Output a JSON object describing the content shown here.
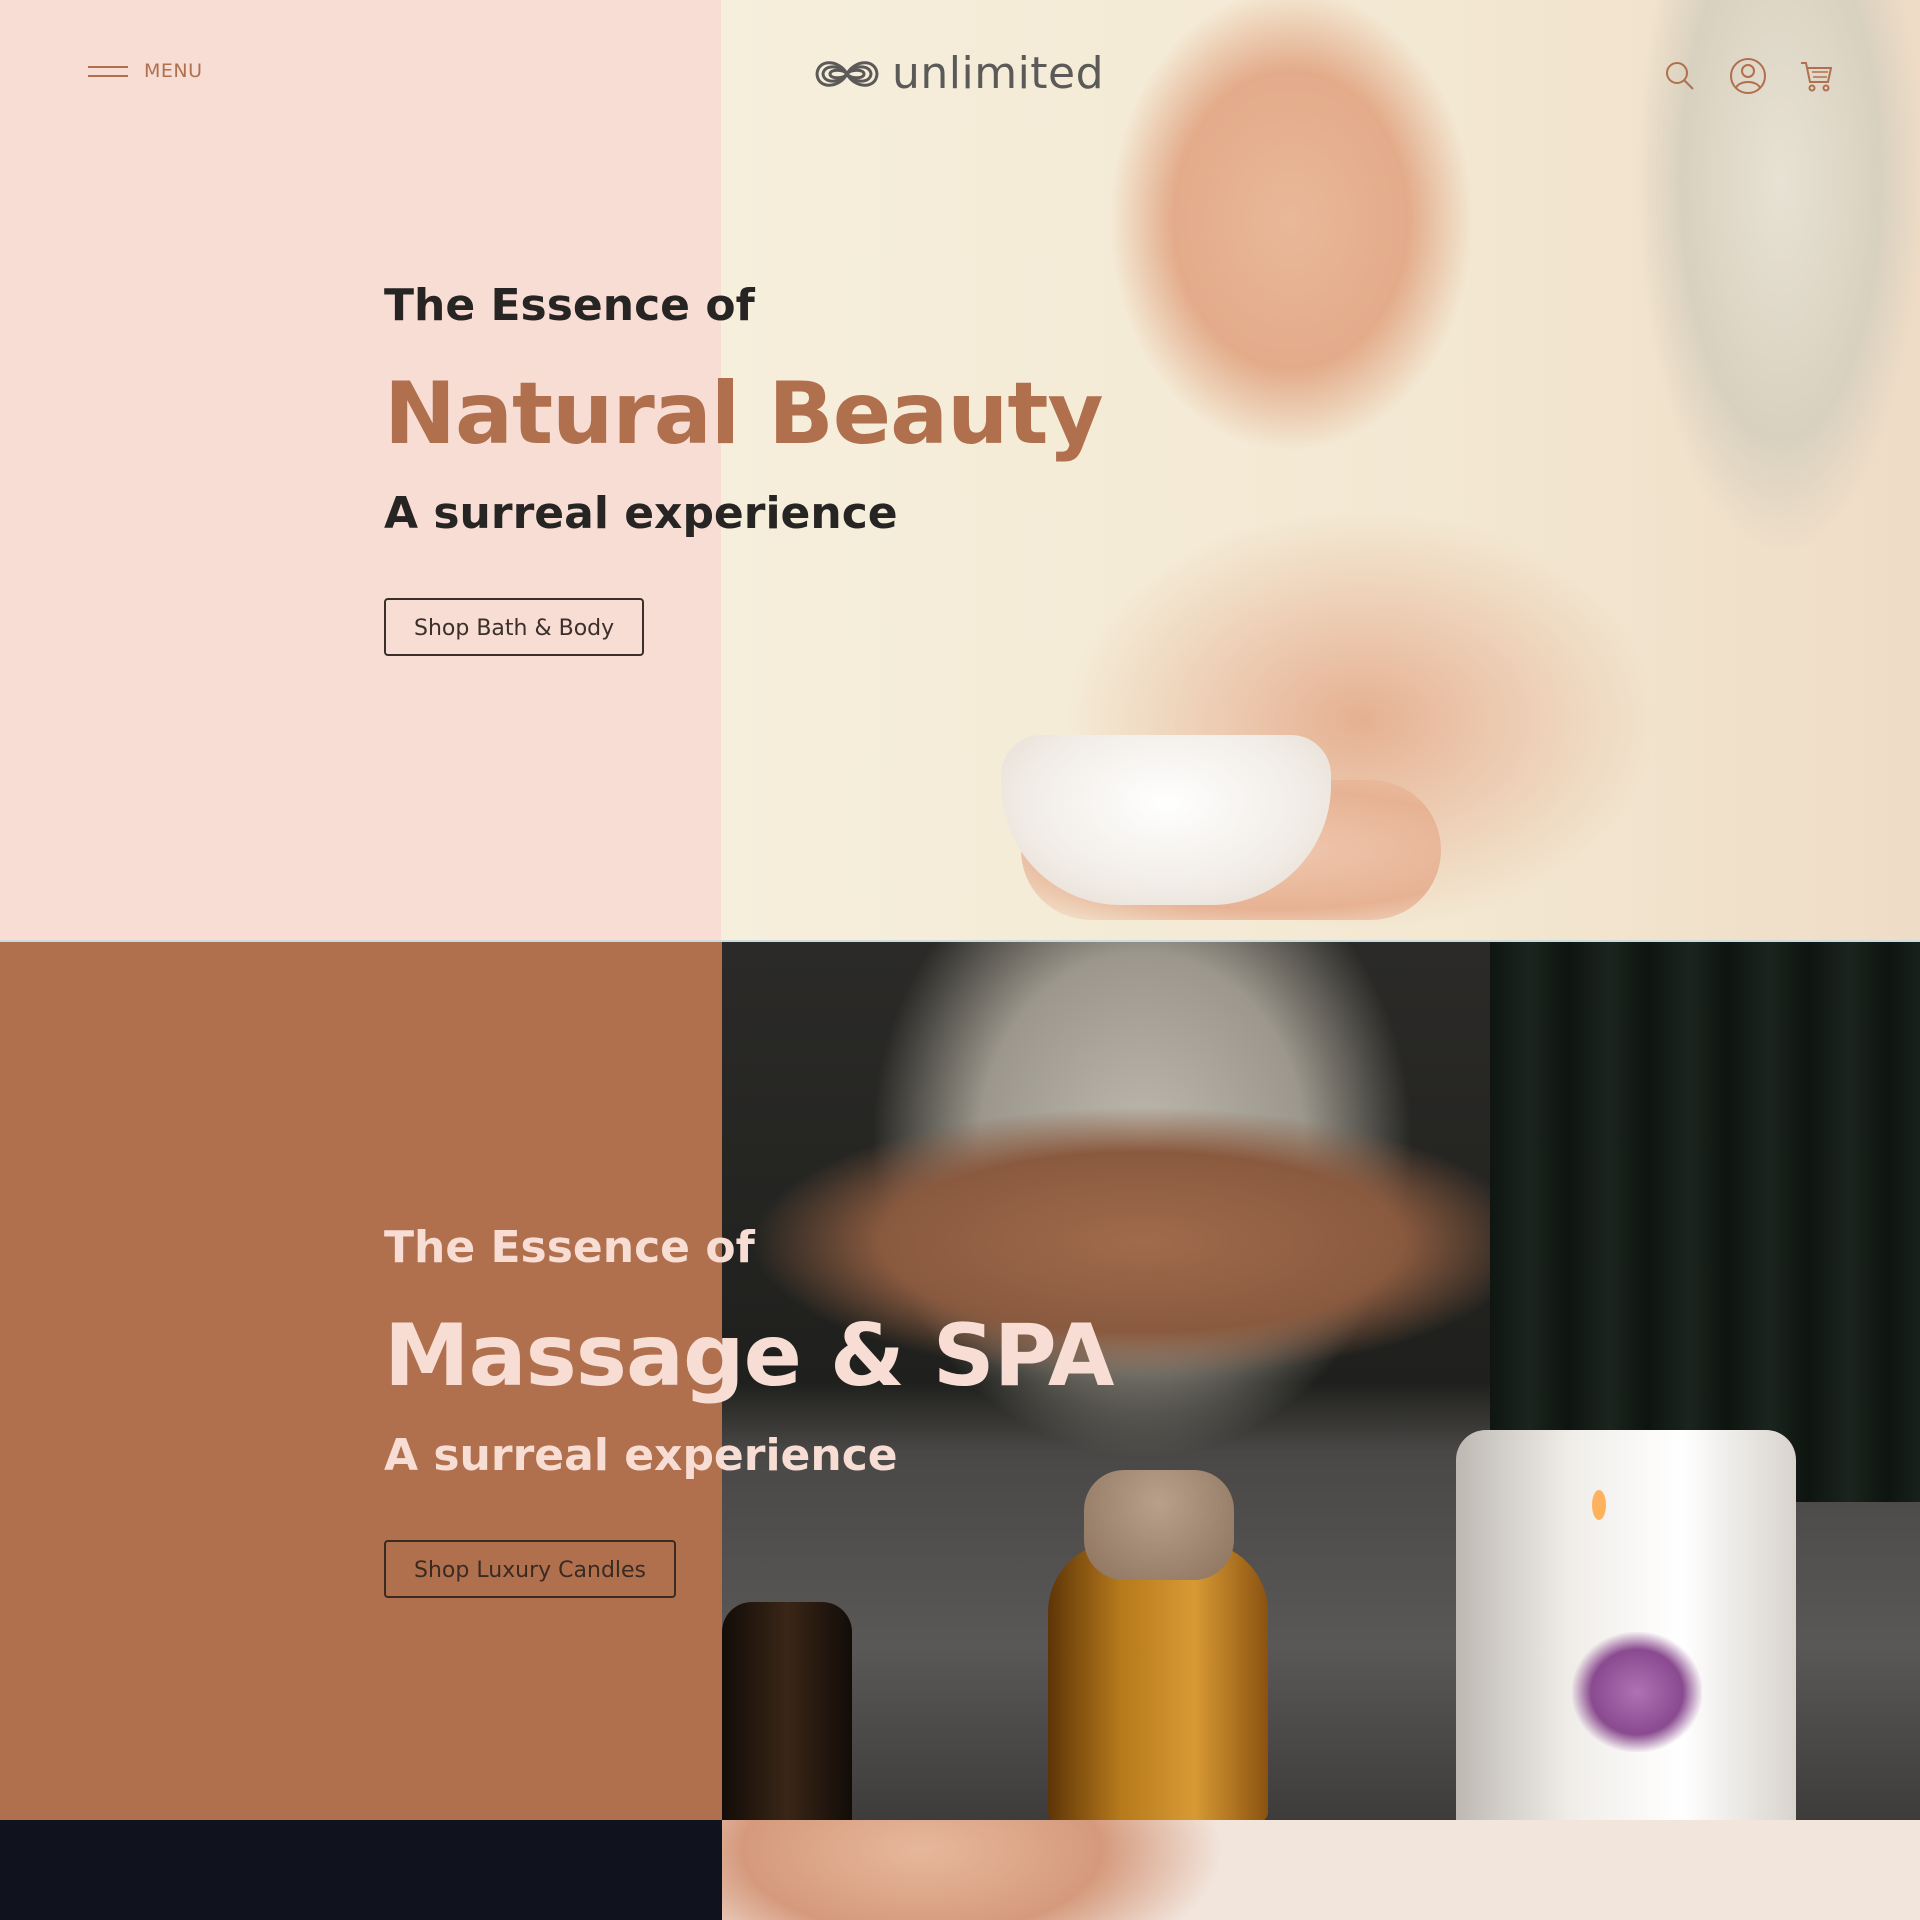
{
  "header": {
    "menu_label": "MENU",
    "logo_text": "unlimited",
    "icons": [
      "search-icon",
      "account-icon",
      "cart-icon"
    ]
  },
  "hero_1": {
    "kicker": "The Essence of",
    "headline": "Natural Beauty",
    "subheadline": "A surreal experience",
    "cta_label": "Shop Bath & Body"
  },
  "hero_2": {
    "kicker": "The Essence of",
    "headline": "Massage & SPA",
    "subheadline": "A surreal experience",
    "cta_label": "Shop Luxury Candles"
  },
  "colors": {
    "blush": "#f8ddd4",
    "terracotta": "#b0704e",
    "navy": "#10131d",
    "text_dark": "#272524",
    "logo_gray": "#5b5a58"
  }
}
